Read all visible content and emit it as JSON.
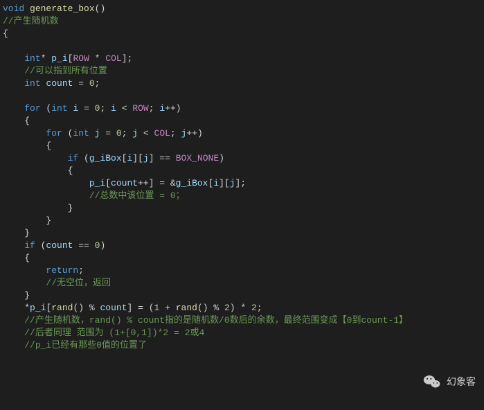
{
  "code": {
    "l01_kw_void": "void",
    "l01_fn": "generate_box",
    "l01_paren": "()",
    "l02_cmt": "//产生随机数",
    "l03_brace": "{",
    "l04_kw_int": "int",
    "l04_star": "*",
    "l04_var": "p_i",
    "l04_br_open": "[",
    "l04_macro_row": "ROW",
    "l04_star2": " * ",
    "l04_macro_col": "COL",
    "l04_br_close": "];",
    "l05_cmt": "//可以指到所有位置",
    "l06_kw_int": "int",
    "l06_var": "count",
    "l06_eq": " = ",
    "l06_num": "0",
    "l06_semi": ";",
    "l08_kw_for": "for",
    "l08_open": " (",
    "l08_kw_int": "int",
    "l08_var_i": "i",
    "l08_eq": " = ",
    "l08_num0": "0",
    "l08_semi1": "; ",
    "l08_var_i2": "i",
    "l08_lt": " < ",
    "l08_macro_row": "ROW",
    "l08_semi2": "; ",
    "l08_var_i3": "i",
    "l08_inc": "++)",
    "l09_brace": "{",
    "l10_kw_for": "for",
    "l10_open": " (",
    "l10_kw_int": "int",
    "l10_var_j": "j",
    "l10_eq": " = ",
    "l10_num0": "0",
    "l10_semi1": "; ",
    "l10_var_j2": "j",
    "l10_lt": " < ",
    "l10_macro_col": "COL",
    "l10_semi2": "; ",
    "l10_var_j3": "j",
    "l10_inc": "++)",
    "l11_brace": "{",
    "l12_kw_if": "if",
    "l12_open": " (",
    "l12_var_box": "g_iBox",
    "l12_idx": "[",
    "l12_var_i": "i",
    "l12_idx2": "][",
    "l12_var_j": "j",
    "l12_idx3": "] == ",
    "l12_macro_none": "BOX_NONE",
    "l12_close": ")",
    "l13_brace": "{",
    "l14_var_pi": "p_i",
    "l14_br1": "[",
    "l14_var_ct": "count",
    "l14_inc": "++] = &",
    "l14_var_box": "g_iBox",
    "l14_br2": "[",
    "l14_var_i": "i",
    "l14_br3": "][",
    "l14_var_j": "j",
    "l14_br4": "];",
    "l15_cmt": "//总数中该位置 = 0；",
    "l16_brace": "}",
    "l17_brace": "}",
    "l18_brace": "}",
    "l19_kw_if": "if",
    "l19_open": " (",
    "l19_var_ct": "count",
    "l19_eq": " == ",
    "l19_num": "0",
    "l19_close": ")",
    "l20_brace": "{",
    "l21_kw_ret": "return",
    "l21_semi": ";",
    "l22_cmt": "//无空位，返回",
    "l23_brace": "}",
    "l24_expr_a": "*",
    "l24_var_pi": "p_i",
    "l24_br1": "[",
    "l24_fn_rand1": "rand",
    "l24_par1": "() % ",
    "l24_var_ct": "count",
    "l24_br2": "] = (",
    "l24_num1": "1",
    "l24_pl": " + ",
    "l24_fn_rand2": "rand",
    "l24_par2": "() % ",
    "l24_num2": "2",
    "l24_cp": ") * ",
    "l24_num3": "2",
    "l24_semi": ";",
    "l25_cmt": "//产生随机数，rand() % count指的是随机数/0数后的余数，最终范围变成【0到count-1】",
    "l26_cmt": "//后者同理 范围为 (1+[0,1])*2 = 2或4",
    "l27_cmt": "//p_i已经有那些0值的位置了"
  },
  "watermark": {
    "label": "幻象客"
  }
}
